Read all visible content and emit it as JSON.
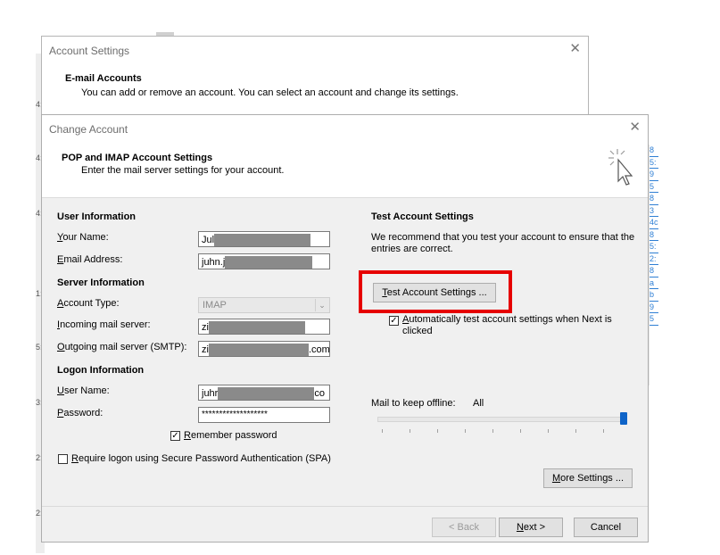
{
  "background": {
    "left_fragments": [
      "4:",
      "4:",
      "4:",
      "1:",
      "5:",
      "3:",
      "2:",
      "2:"
    ],
    "rail_fragments": [
      "8",
      "5:",
      "9",
      "5",
      "8",
      "3",
      "4c",
      "8",
      "5:",
      "2:",
      "8",
      "a",
      "b",
      "9",
      "5"
    ]
  },
  "account_settings": {
    "title": "Account Settings",
    "heading": "E-mail Accounts",
    "subtext": "You can add or remove an account. You can select an account and change its settings."
  },
  "change_account": {
    "title": "Change Account",
    "heading": "POP and IMAP Account Settings",
    "subtext": "Enter the mail server settings for your account.",
    "user_info": {
      "section": "User Information",
      "your_name_label": "Your Name:",
      "your_name_value": "Jul",
      "email_label": "Email Address:",
      "email_value": "juhn.j"
    },
    "server_info": {
      "section": "Server Information",
      "account_type_label": "Account Type:",
      "account_type_value": "IMAP",
      "incoming_label": "Incoming mail server:",
      "incoming_value": "zi",
      "outgoing_label": "Outgoing mail server (SMTP):",
      "outgoing_value": "zi",
      "outgoing_suffix": ".com"
    },
    "logon_info": {
      "section": "Logon Information",
      "user_name_label": "User Name:",
      "user_name_value": "juhr",
      "user_name_suffix": "co",
      "password_label": "Password:",
      "password_value": "*******************",
      "remember_label": "Remember password",
      "spa_label": "Require logon using Secure Password Authentication (SPA)"
    },
    "test_settings": {
      "section": "Test Account Settings",
      "description": "We recommend that you test your account to ensure that the entries are correct.",
      "test_button": "Test Account Settings ...",
      "auto_test_label": "Automatically test account settings when Next is clicked"
    },
    "offline": {
      "label": "Mail to keep offline:",
      "value": "All",
      "slider_level": 1.0
    },
    "buttons": {
      "more_settings": "More Settings ...",
      "back": "< Back",
      "next": "Next >",
      "cancel": "Cancel"
    }
  }
}
